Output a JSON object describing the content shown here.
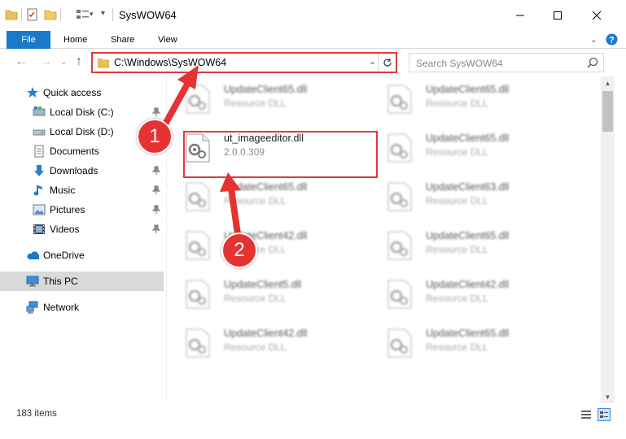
{
  "window": {
    "title": "SysWOW64",
    "minimize_icon": "minimize-icon",
    "maximize_icon": "maximize-icon",
    "close_icon": "close-icon"
  },
  "ribbon": {
    "tabs": [
      {
        "label": "File"
      },
      {
        "label": "Home"
      },
      {
        "label": "Share"
      },
      {
        "label": "View"
      }
    ]
  },
  "nav": {
    "address": "C:\\Windows\\SysWOW64",
    "search_placeholder": "Search SysWOW64"
  },
  "sidebar": {
    "items": [
      {
        "label": "Quick access"
      },
      {
        "label": "Local Disk (C:)"
      },
      {
        "label": "Local Disk (D:)"
      },
      {
        "label": "Documents"
      },
      {
        "label": "Downloads"
      },
      {
        "label": "Music"
      },
      {
        "label": "Pictures"
      },
      {
        "label": "Videos"
      },
      {
        "label": "OneDrive"
      },
      {
        "label": "This PC"
      },
      {
        "label": "Network"
      }
    ]
  },
  "files": {
    "left": [
      {
        "name": "UpdateClient65.dll",
        "desc": "Resource DLL"
      },
      {
        "name": "ut_imageeditor.dll",
        "desc": "2.0.0.309"
      },
      {
        "name": "UpdateClient65.dll",
        "desc": "Resource DLL"
      },
      {
        "name": "UpdateClient42.dll",
        "desc": "Resource DLL"
      },
      {
        "name": "UpdateClient5.dll",
        "desc": "Resource DLL"
      },
      {
        "name": "UpdateClient42.dll",
        "desc": "Resource DLL"
      }
    ],
    "right": [
      {
        "name": "UpdateClient65.dll",
        "desc": "Resource DLL"
      },
      {
        "name": "UpdateClient65.dll",
        "desc": "Resource DLL"
      },
      {
        "name": "UpdateClient63.dll",
        "desc": "Resource DLL"
      },
      {
        "name": "UpdateClient65.dll",
        "desc": "Resource DLL"
      },
      {
        "name": "UpdateClient42.dll",
        "desc": "Resource DLL"
      },
      {
        "name": "UpdateClient65.dll",
        "desc": "Resource DLL"
      }
    ]
  },
  "status": {
    "item_count": "183 items"
  },
  "annotations": {
    "step1": "1",
    "step2": "2"
  },
  "colors": {
    "accent": "#1979ca",
    "highlight": "#e03a3a",
    "badge": "#e53333"
  }
}
